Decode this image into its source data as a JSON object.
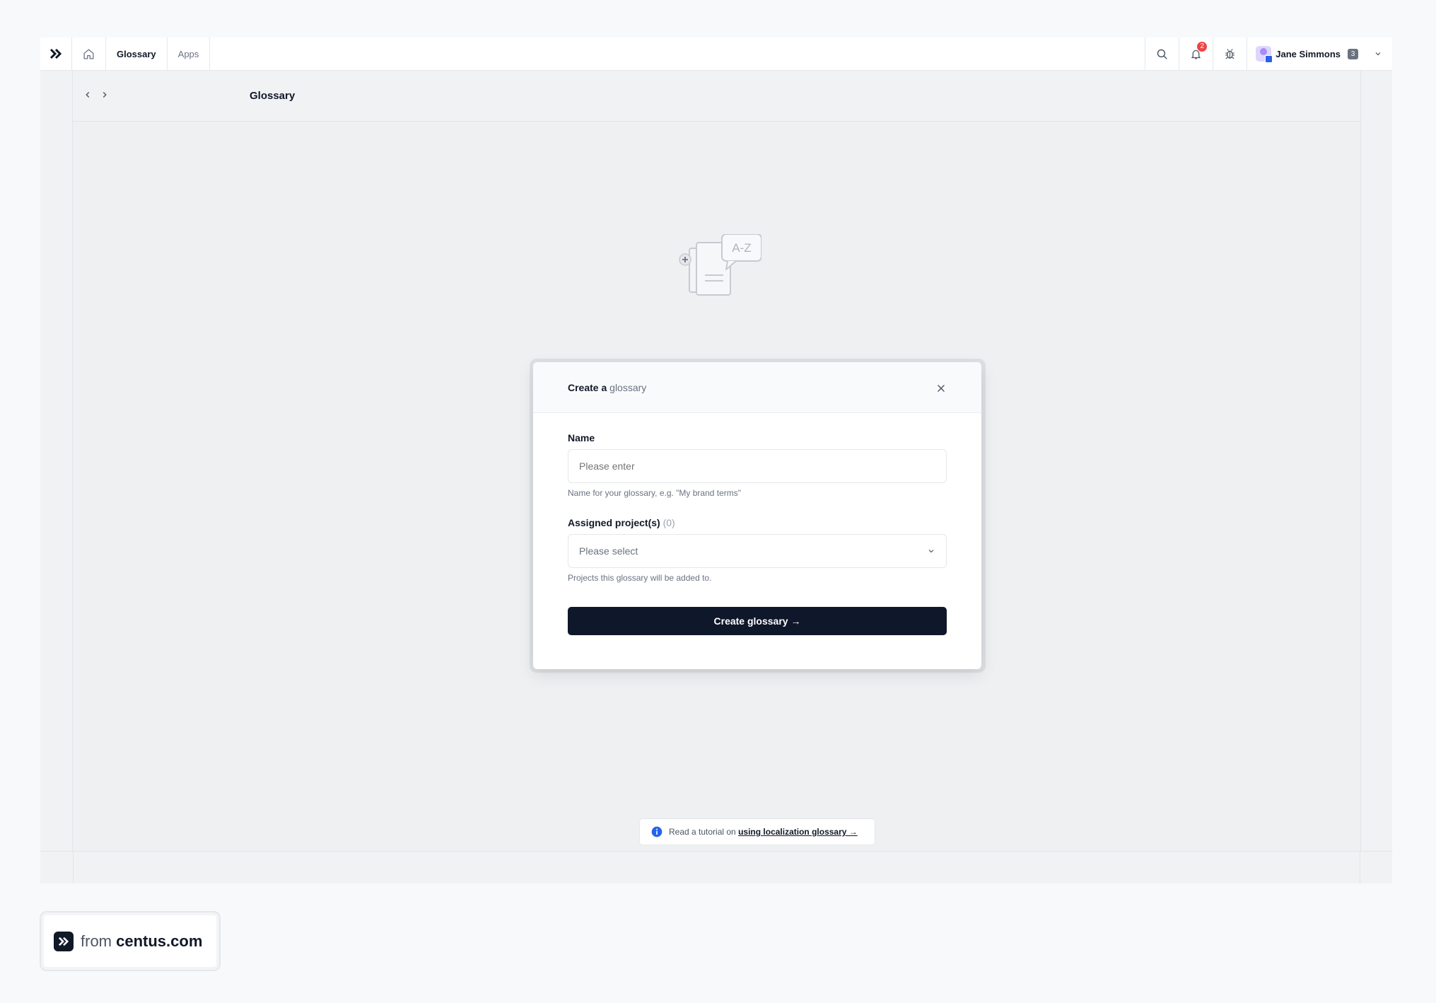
{
  "topbar": {
    "tabs": [
      {
        "label": "Glossary",
        "active": true
      },
      {
        "label": "Apps",
        "active": false
      }
    ],
    "notification_count": "2",
    "user": {
      "name": "Jane Simmons",
      "count": "3"
    }
  },
  "subheader": {
    "title": "Glossary"
  },
  "illustration": {
    "text": "A-Z"
  },
  "modal": {
    "title_prefix": "Create a",
    "title_accent": "glossary",
    "name_label": "Name",
    "name_placeholder": "Please enter",
    "name_hint": "Name for your glossary, e.g. \"My brand terms\"",
    "projects_label": "Assigned project(s)",
    "projects_count": "(0)",
    "projects_placeholder": "Please select",
    "projects_hint": "Projects this glossary will be added to.",
    "submit_label": "Create glossary →"
  },
  "tutorial": {
    "prefix": "Read a tutorial on",
    "link": "using localization glossary →"
  },
  "brand": {
    "from": "from",
    "domain": "centus.com"
  },
  "colors": {
    "primary": "#0f172a",
    "badge": "#ef4444",
    "info": "#2563eb",
    "accent_text": "#6b7280"
  }
}
